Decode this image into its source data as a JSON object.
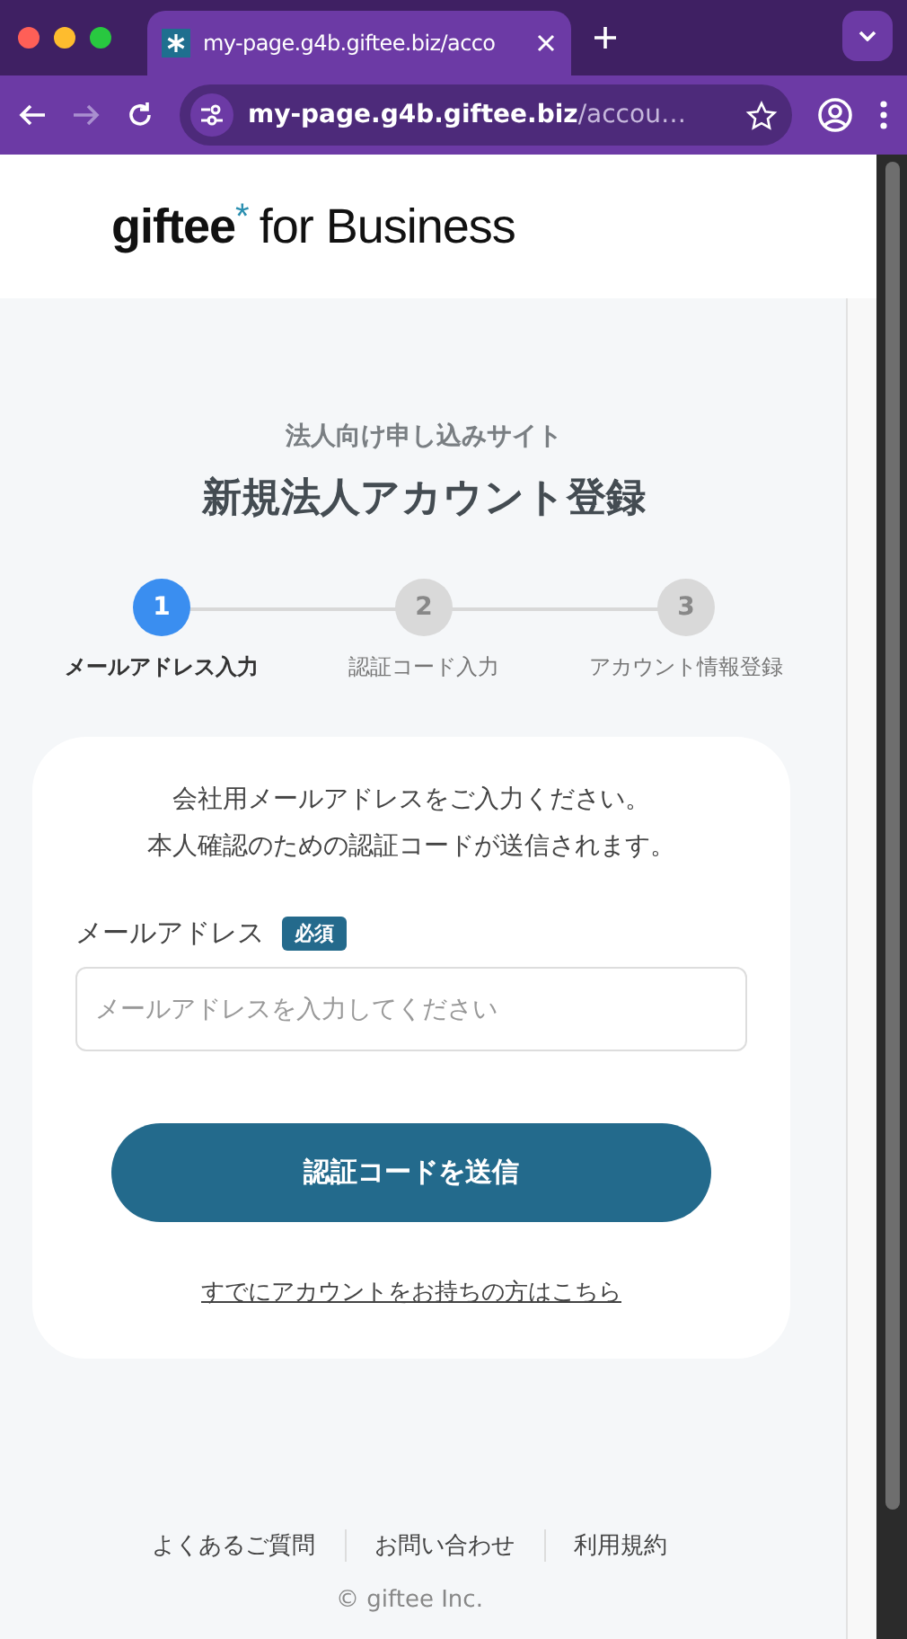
{
  "browser": {
    "tab": {
      "title": "my-page.g4b.giftee.biz/acco",
      "selected": true
    },
    "url": {
      "host": "my-page.g4b.giftee.biz",
      "path": "/accou…"
    }
  },
  "header": {
    "logo": {
      "brand": "giftee",
      "mark": "*",
      "suffix": "for Business"
    }
  },
  "page": {
    "subtitle": "法人向け申し込みサイト",
    "title": "新規法人アカウント登録"
  },
  "steps": [
    {
      "number": "1",
      "label": "メールアドレス入力",
      "selected": true
    },
    {
      "number": "2",
      "label": "認証コード入力",
      "selected": false
    },
    {
      "number": "3",
      "label": "アカウント情報登録",
      "selected": false
    }
  ],
  "form": {
    "intro": [
      "会社用メールアドレスをご入力ください。",
      "本人確認のための認証コードが送信されます。"
    ],
    "field": {
      "label": "メールアドレス",
      "badge": "必須",
      "placeholder": "メールアドレスを入力してください"
    },
    "submit": "認証コードを送信",
    "link": "すでにアカウントをお持ちの方はこちら"
  },
  "footer": {
    "links": [
      "よくあるご質問",
      "お問い合わせ",
      "利用規約"
    ],
    "copyright": "© giftee Inc."
  }
}
